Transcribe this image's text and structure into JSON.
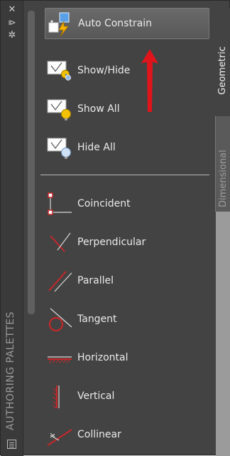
{
  "palette": {
    "title": "AUTHORING PALETTES"
  },
  "tabs": [
    {
      "label": "Geometric",
      "active": true
    },
    {
      "label": "Dimensional",
      "active": false
    }
  ],
  "tools": [
    {
      "label": "Auto Constrain",
      "icon": "auto-constrain-icon",
      "active": true
    },
    {
      "label": "Show/Hide",
      "icon": "show-hide-icon"
    },
    {
      "label": "Show All",
      "icon": "show-all-icon"
    },
    {
      "label": "Hide All",
      "icon": "hide-all-icon"
    },
    {
      "label": "Coincident",
      "icon": "coincident-icon"
    },
    {
      "label": "Perpendicular",
      "icon": "perpendicular-icon"
    },
    {
      "label": "Parallel",
      "icon": "parallel-icon"
    },
    {
      "label": "Tangent",
      "icon": "tangent-icon"
    },
    {
      "label": "Horizontal",
      "icon": "horizontal-icon"
    },
    {
      "label": "Vertical",
      "icon": "vertical-icon"
    },
    {
      "label": "Collinear",
      "icon": "collinear-icon"
    }
  ],
  "colors": {
    "annotation_arrow": "#e0141b",
    "constraint_red": "#c4282a",
    "bulb_yellow": "#f2c200"
  }
}
